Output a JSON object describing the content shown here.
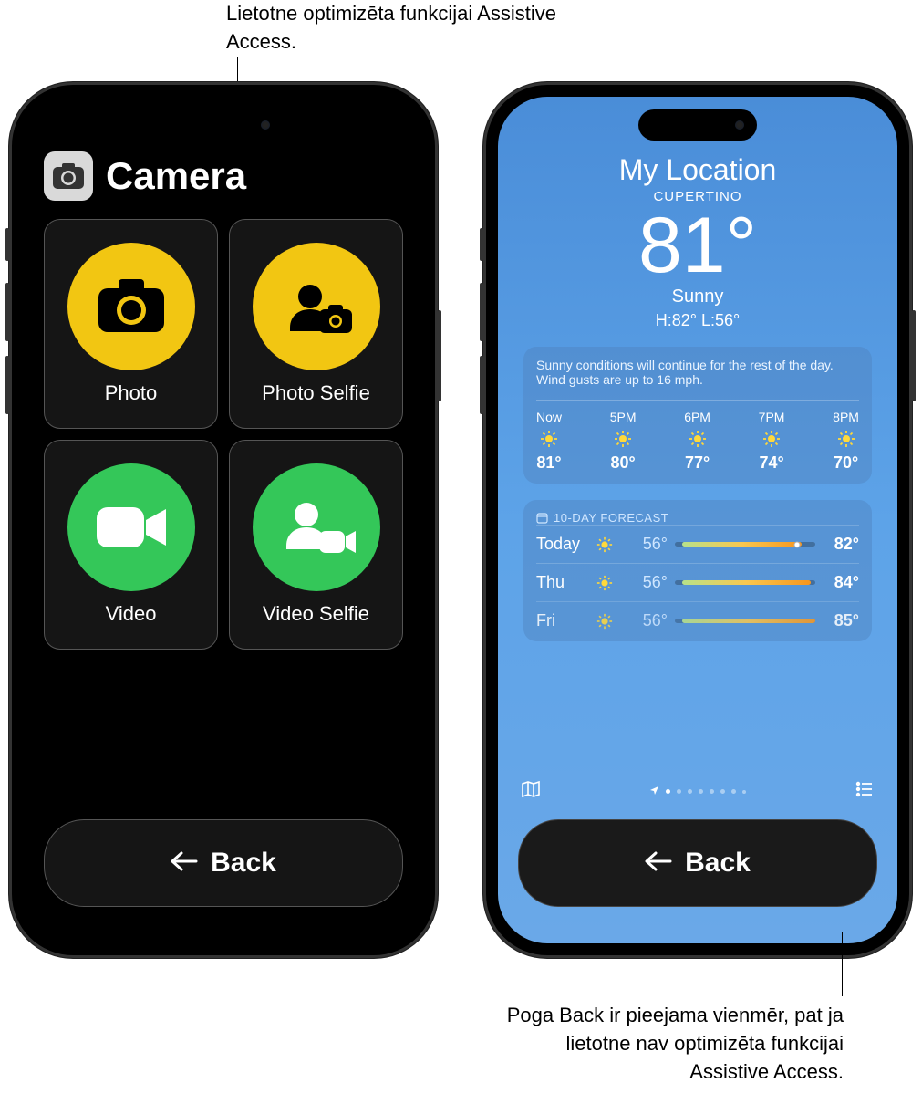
{
  "callouts": {
    "top": "Lietotne optimizēta funkcijai Assistive Access.",
    "bottom": "Poga Back ir pieejama vienmēr, pat ja lietotne nav optimizēta funkcijai Assistive Access."
  },
  "camera": {
    "title": "Camera",
    "tiles": {
      "photo": "Photo",
      "photo_selfie": "Photo Selfie",
      "video": "Video",
      "video_selfie": "Video Selfie"
    },
    "back": "Back"
  },
  "weather": {
    "my_location": "My Location",
    "city": "CUPERTINO",
    "temp": "81°",
    "condition": "Sunny",
    "hi_lo": "H:82°  L:56°",
    "summary": "Sunny conditions will continue for the rest of the day. Wind gusts are up to 16 mph.",
    "hourly": [
      {
        "time": "Now",
        "temp": "81°"
      },
      {
        "time": "5PM",
        "temp": "80°"
      },
      {
        "time": "6PM",
        "temp": "77°"
      },
      {
        "time": "7PM",
        "temp": "74°"
      },
      {
        "time": "8PM",
        "temp": "70°"
      }
    ],
    "ten_day_label": "10-DAY FORECAST",
    "daily": [
      {
        "day": "Today",
        "lo": "56°",
        "hi": "82°"
      },
      {
        "day": "Thu",
        "lo": "56°",
        "hi": "84°"
      },
      {
        "day": "Fri",
        "lo": "56°",
        "hi": "85°"
      }
    ],
    "back": "Back"
  }
}
